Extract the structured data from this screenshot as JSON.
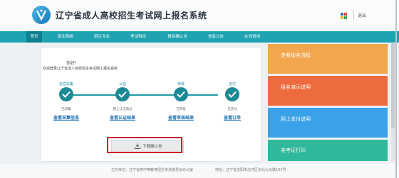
{
  "header": {
    "title": "辽宁省成人高校招生考试网上报名系统",
    "logout_label": "退出",
    "logo_icon": "v-emblem-icon",
    "lang_icon": "color-grid-icon"
  },
  "nav": {
    "items": [
      {
        "label": "首页",
        "active": true
      },
      {
        "label": "招生院校"
      },
      {
        "label": "招生专业"
      },
      {
        "label": "考试科目"
      },
      {
        "label": "报名确认点"
      },
      {
        "label": "信息公告"
      },
      {
        "label": "在线咨询"
      }
    ],
    "bg_color": "#1fa3b1",
    "active_color": "#0d7f8f"
  },
  "main": {
    "greeting": "你好！",
    "welcome": "欢迎登录辽宁省成人高校招生考试网上报名系统",
    "steps": [
      {
        "top": "信息采集",
        "status": "已采集",
        "link": "查看采集信息"
      },
      {
        "top": "认证",
        "status": "网上认证通过",
        "link": "查看认证结果"
      },
      {
        "top": "审核",
        "status": "已审核",
        "link": "查看审核结果"
      },
      {
        "top": "支付",
        "status": "已支付",
        "link": "查看订单"
      }
    ],
    "download_button": "下载确认单",
    "download_icon": "download-icon"
  },
  "tiles": [
    {
      "label": "查看报名流程",
      "color": "#f2a64d"
    },
    {
      "label": "报名演示说明",
      "color": "#ee6a3f"
    },
    {
      "label": "网上支付说明",
      "color": "#3aa2e8"
    },
    {
      "label": "准考证打印",
      "color": "#2fb89b"
    }
  ],
  "footer": {
    "host": "主办单位：辽宁省高中等教育招生考试委员会办公室",
    "address": "地址：辽宁省沈阳市沈河区东北大马路101号"
  }
}
